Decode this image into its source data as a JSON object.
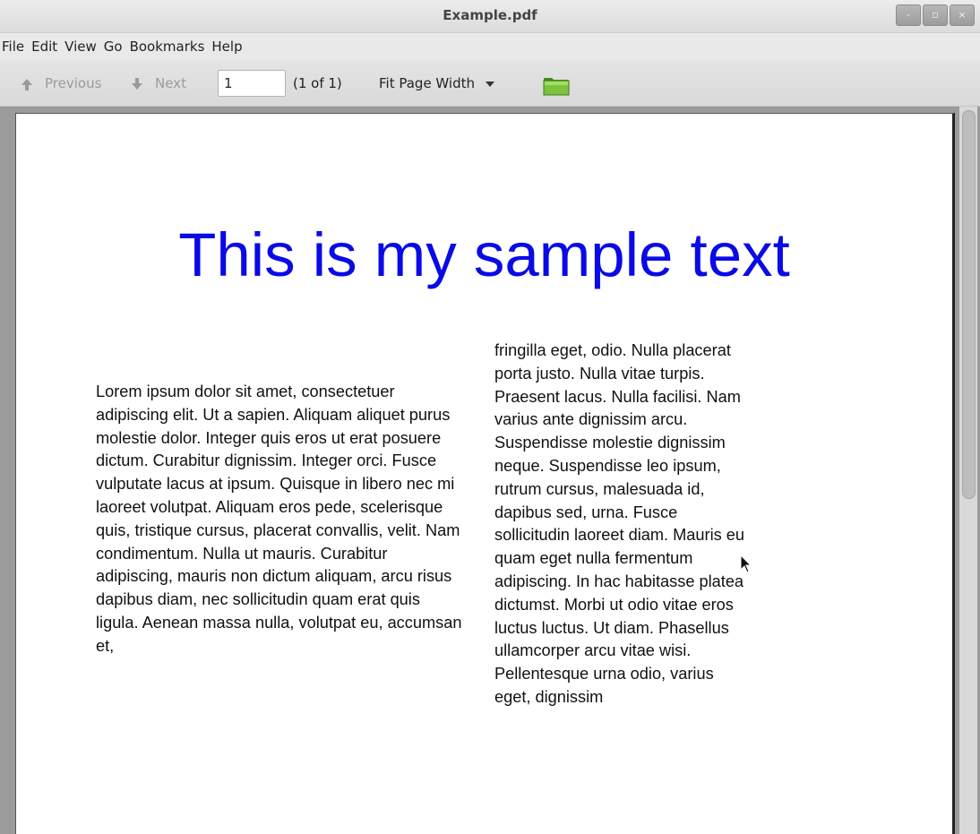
{
  "window": {
    "title": "Example.pdf",
    "controls": {
      "minimize": "-",
      "maximize": "▫",
      "close": "×"
    }
  },
  "menu": [
    "File",
    "Edit",
    "View",
    "Go",
    "Bookmarks",
    "Help"
  ],
  "toolbar": {
    "previous_label": "Previous",
    "next_label": "Next",
    "page_value": "1",
    "page_count": "(1 of 1)",
    "zoom_label": "Fit Page Width",
    "folder_icon": "folder-icon"
  },
  "document": {
    "heading": "This is my sample text",
    "heading_color": "#0a0ae6",
    "column_left": "Lorem ipsum dolor sit amet, consectetuer adipiscing elit. Ut a sapien. Aliquam aliquet purus molestie dolor. Integer quis eros ut erat posuere dictum. Curabitur dignissim. Integer orci. Fusce vulputate lacus at ipsum. Quisque in libero nec mi laoreet volutpat. Aliquam eros pede, scelerisque quis, tristique cursus, placerat convallis, velit. Nam condimentum. Nulla ut mauris. Curabitur adipiscing, mauris non dictum aliquam, arcu risus dapibus diam, nec sollicitudin quam erat quis ligula. Aenean massa nulla, volutpat eu, accumsan et,",
    "column_right": "fringilla eget, odio. Nulla placerat porta justo. Nulla vitae turpis. Praesent lacus. Nulla facilisi. Nam varius ante dignissim arcu. Suspendisse molestie dignissim neque. Suspendisse leo ipsum, rutrum cursus, malesuada id, dapibus sed, urna. Fusce sollicitudin laoreet diam. Mauris eu quam eget nulla fermentum adipiscing. In hac habitasse platea dictumst. Morbi ut odio vitae eros luctus luctus. Ut diam. Phasellus ullamcorper arcu vitae wisi. Pellentesque urna odio, varius eget, dignissim"
  }
}
